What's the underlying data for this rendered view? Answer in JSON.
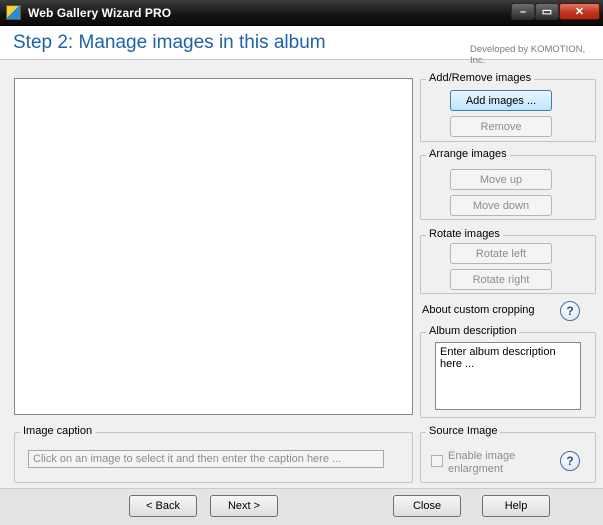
{
  "window": {
    "title": "Web Gallery Wizard PRO",
    "app_icon": "wizard-app-icon"
  },
  "header": {
    "step_title": "Step 2: Manage images in this album",
    "developed_by": "Developed by KOMOTION, Inc."
  },
  "groups": {
    "add_remove": {
      "title": "Add/Remove images",
      "add_label": "Add images ...",
      "remove_label": "Remove"
    },
    "arrange": {
      "title": "Arrange images",
      "move_up_label": "Move up",
      "move_down_label": "Move down"
    },
    "rotate": {
      "title": "Rotate images",
      "rotate_left_label": "Rotate left",
      "rotate_right_label": "Rotate right"
    },
    "custom_cropping": {
      "label": "About custom cropping"
    },
    "album_description": {
      "title": "Album description",
      "value": "Enter album description here ..."
    },
    "image_caption": {
      "title": "Image caption",
      "placeholder": "Click on an image to select it and then enter the caption here ..."
    },
    "source_image": {
      "title": "Source Image",
      "enable_label": "Enable image enlargment"
    }
  },
  "footer": {
    "back_label": "< Back",
    "next_label": "Next >",
    "close_label": "Close",
    "help_label": "Help"
  },
  "colors": {
    "accent": "#1f62a8",
    "titlebar": "#141414",
    "close": "#c0351c"
  }
}
